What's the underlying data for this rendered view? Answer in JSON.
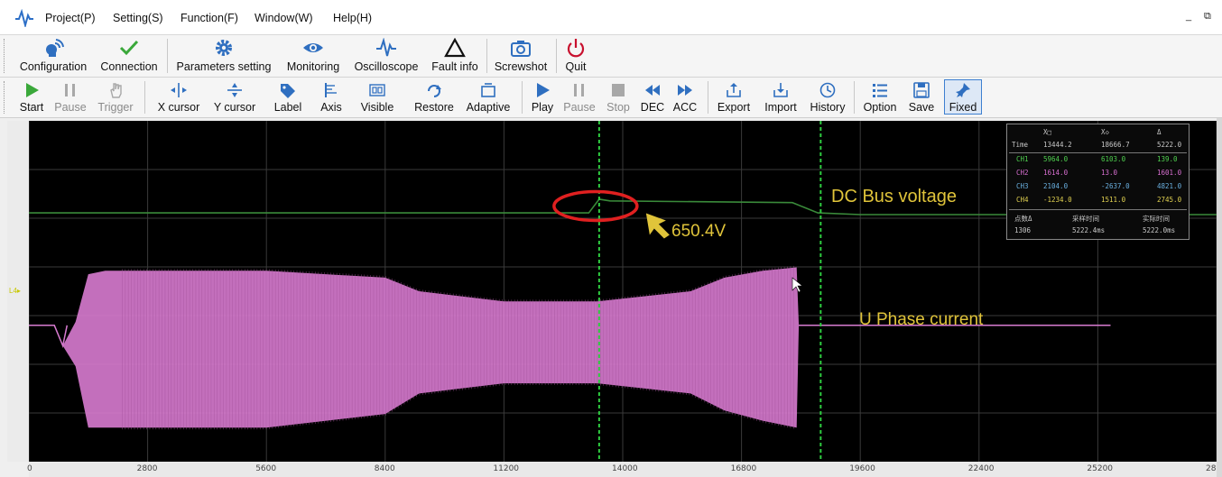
{
  "menu": {
    "items": [
      "Project(P)",
      "Setting(S)",
      "Function(F)",
      "Window(W)",
      "Help(H)"
    ],
    "minimize": "_",
    "restore": "⧉"
  },
  "toolbar_main": {
    "configuration": "Configuration",
    "connection": "Connection",
    "parameters": "Parameters setting",
    "monitoring": "Monitoring",
    "oscilloscope": "Oscilloscope",
    "fault": "Fault info",
    "screenshot": "Screwshot",
    "quit": "Quit"
  },
  "toolbar_scope": {
    "start": "Start",
    "pause": "Pause",
    "trigger": "Trigger",
    "x_cursor": "X cursor",
    "y_cursor": "Y cursor",
    "label": "Label",
    "axis": "Axis",
    "visible": "Visible",
    "restore": "Restore",
    "adaptive": "Adaptive",
    "play": "Play",
    "pause2": "Pause",
    "stop": "Stop",
    "dec": "DEC",
    "acc": "ACC",
    "export": "Export",
    "import": "Import",
    "history": "History",
    "option": "Option",
    "save": "Save",
    "fixed": "Fixed"
  },
  "scope": {
    "annotations": {
      "dc_bus": "DC Bus voltage",
      "u_phase": "U Phase current",
      "peak": "650.4V"
    },
    "left_marker": "L4▸",
    "colors": {
      "background": "#000000",
      "grid": "#3a3a3a",
      "dc_bus": "#3a8a3a",
      "u_phase": "#d87bd0",
      "cursor": "#2ecc40",
      "annotation": "#e0c43a",
      "circle": "#e02020"
    },
    "measure": {
      "time_label": "Time",
      "cursor_col1": "X□",
      "cursor_col2": "X◇",
      "delta_col": "Δ",
      "time_values": [
        "13444.2",
        "18666.7",
        "5222.0"
      ],
      "rows": [
        {
          "name": "CH1",
          "values": [
            "5964.0",
            "6103.0",
            "139.0"
          ],
          "color": "#4fd14f"
        },
        {
          "name": "CH2",
          "values": [
            "1614.0",
            "13.0",
            "1601.0"
          ],
          "color": "#d76fd0"
        },
        {
          "name": "CH3",
          "values": [
            "2104.0",
            "-2637.0",
            "4821.0"
          ],
          "color": "#6ab0e0"
        },
        {
          "name": "CH4",
          "values": [
            "-1234.0",
            "1511.0",
            "2745.0"
          ],
          "color": "#e0d050"
        }
      ],
      "footer_labels": [
        "点数Δ",
        "采样时间",
        "实际时间"
      ],
      "footer_values": [
        "1306",
        "5222.4ms",
        "5222.0ms"
      ]
    }
  },
  "chart_data": {
    "type": "line",
    "x_ticks": [
      "0",
      "2800",
      "5600",
      "8400",
      "11200",
      "14000",
      "16800",
      "19600",
      "22400",
      "25200",
      "28"
    ],
    "xlim": [
      0,
      28000
    ],
    "cursors_x": [
      13444.2,
      18666.7
    ],
    "series": [
      {
        "name": "DC Bus voltage",
        "x": [
          0,
          13200,
          13444,
          13700,
          18000,
          18600,
          19600,
          28000
        ],
        "y": [
          0.27,
          0.27,
          0.23,
          0.235,
          0.24,
          0.27,
          0.275,
          0.275
        ]
      },
      {
        "name": "U Phase current",
        "x": [
          0,
          600,
          800,
          1100,
          1400,
          1800,
          2200,
          5600,
          8400,
          9200,
          11200,
          13400,
          15600,
          16400,
          17300,
          18100,
          18150,
          18400,
          25500
        ],
        "y_upper": [
          0.6,
          0.6,
          0.66,
          0.59,
          0.45,
          0.44,
          0.44,
          0.44,
          0.46,
          0.5,
          0.53,
          0.53,
          0.5,
          0.46,
          0.44,
          0.43,
          0.6,
          0.6,
          0.6
        ],
        "y_lower": [
          0.6,
          0.6,
          0.66,
          0.72,
          0.9,
          0.9,
          0.9,
          0.9,
          0.86,
          0.8,
          0.77,
          0.77,
          0.8,
          0.85,
          0.88,
          0.9,
          0.6,
          0.6,
          0.6
        ]
      }
    ]
  }
}
